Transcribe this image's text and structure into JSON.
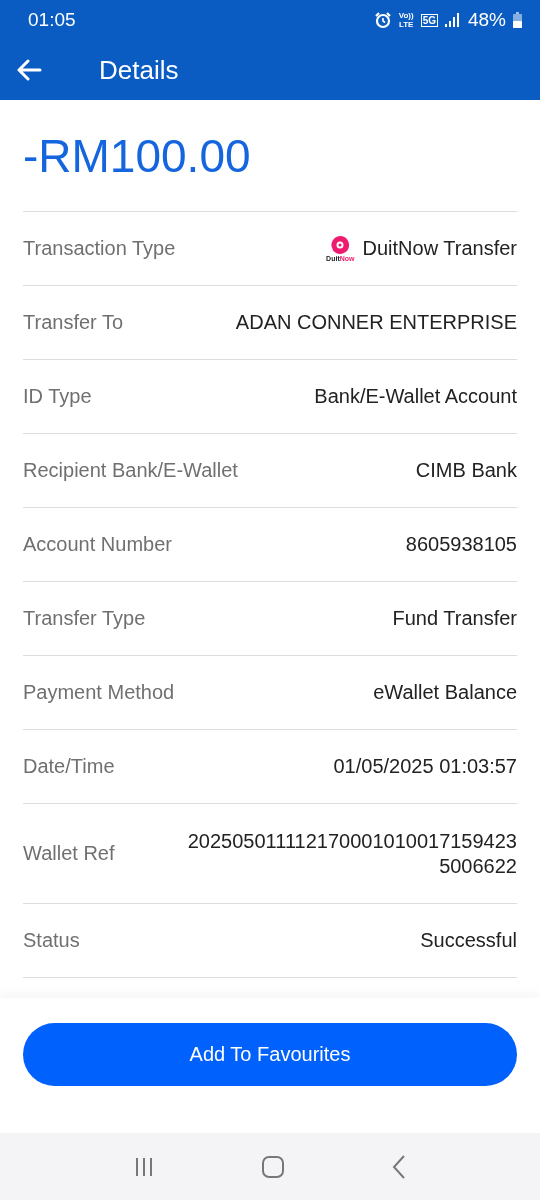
{
  "status_bar": {
    "time": "01:05",
    "volte": [
      "Vo))",
      "LTE"
    ],
    "network": "5G",
    "battery": "48%"
  },
  "header": {
    "title": "Details"
  },
  "amount": "-RM100.00",
  "rows": [
    {
      "label": "Transaction Type",
      "value": "DuitNow Transfer",
      "logo": [
        "Duit",
        "Now"
      ]
    },
    {
      "label": "Transfer To",
      "value": "ADAN CONNER ENTERPRISE"
    },
    {
      "label": "ID Type",
      "value": "Bank/E-Wallet Account"
    },
    {
      "label": "Recipient Bank/E-Wallet",
      "value": "CIMB Bank"
    },
    {
      "label": "Account Number",
      "value": "8605938105"
    },
    {
      "label": "Transfer Type",
      "value": "Fund Transfer"
    },
    {
      "label": "Payment Method",
      "value": "eWallet Balance"
    },
    {
      "label": "Date/Time",
      "value": "01/05/2025 01:03:57"
    },
    {
      "label": "Wallet Ref",
      "value": "2025050111121700010100171594235006622"
    },
    {
      "label": "Status",
      "value": "Successful"
    }
  ],
  "button": "Add To Favourites"
}
